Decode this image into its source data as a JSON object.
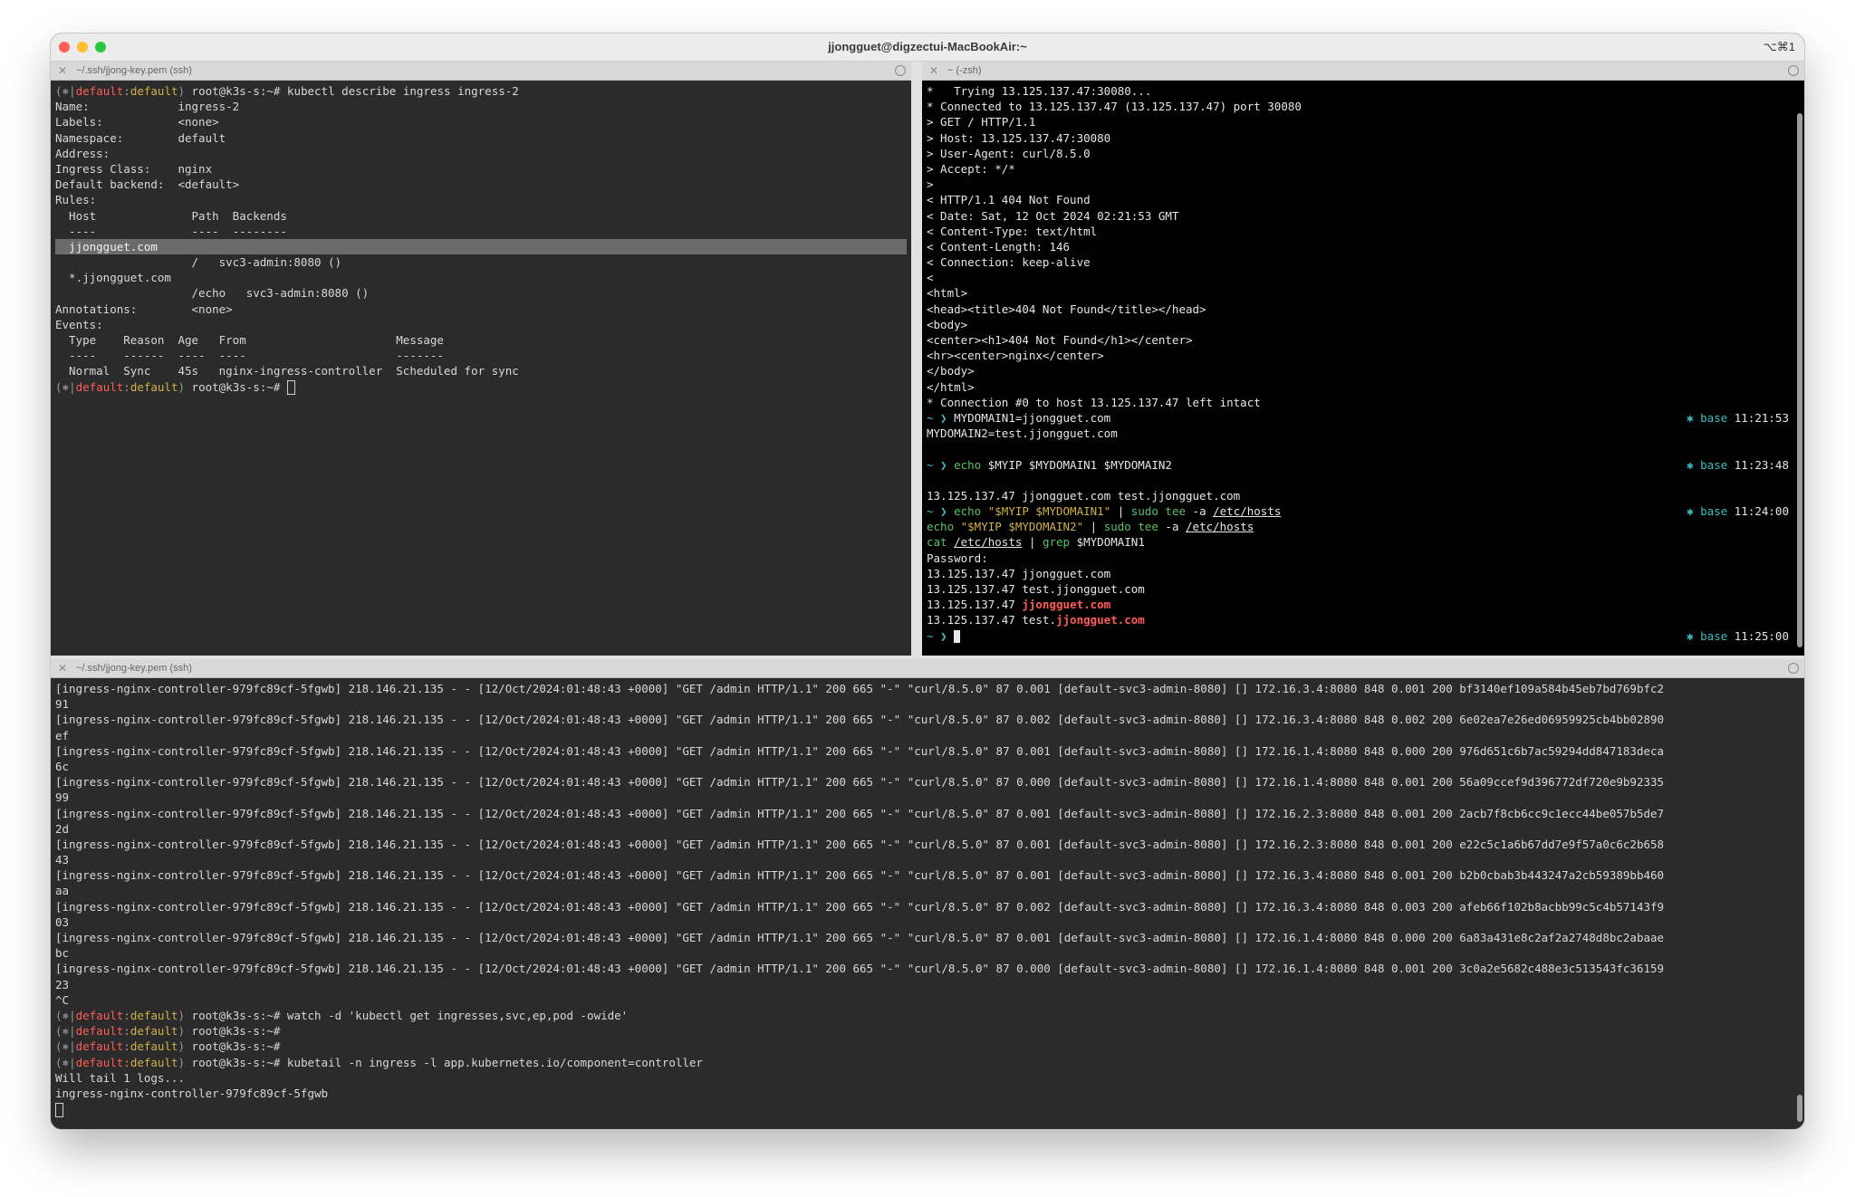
{
  "window": {
    "title": "jjongguet@digzectui-MacBookAir:~",
    "shortcut": "⌥⌘1"
  },
  "panes": {
    "left_top": {
      "tab_title": "~/.ssh/jjong-key.pem (ssh)",
      "lines": [
        "kubectl describe ingress ingress-2",
        "Name:             ingress-2",
        "Labels:           <none>",
        "Namespace:        default",
        "Address:",
        "Ingress Class:    nginx",
        "Default backend:  <default>",
        "Rules:",
        "  Host              Path  Backends",
        "  ----              ----  --------",
        "  jjongguet.com",
        "                    /   svc3-admin:8080 ()",
        "  *.jjongguet.com",
        "                    /echo   svc3-admin:8080 ()",
        "Annotations:        <none>",
        "Events:",
        "  Type    Reason  Age   From                      Message",
        "  ----    ------  ----  ----                      -------",
        "  Normal  Sync    45s   nginx-ingress-controller  Scheduled for sync"
      ]
    },
    "right_top": {
      "tab_title": "~ (-zsh)",
      "lines": [
        "*   Trying 13.125.137.47:30080...",
        "* Connected to 13.125.137.47 (13.125.137.47) port 30080",
        "> GET / HTTP/1.1",
        "> Host: 13.125.137.47:30080",
        "> User-Agent: curl/8.5.0",
        "> Accept: */*",
        ">",
        "< HTTP/1.1 404 Not Found",
        "< Date: Sat, 12 Oct 2024 02:21:53 GMT",
        "< Content-Type: text/html",
        "< Content-Length: 146",
        "< Connection: keep-alive",
        "<",
        "<html>",
        "<head><title>404 Not Found</title></head>",
        "<body>",
        "<center><h1>404 Not Found</h1></center>",
        "<hr><center>nginx</center>",
        "</body>",
        "</html>",
        "* Connection #0 to host 13.125.137.47 left intact"
      ],
      "cmd1": "MYDOMAIN1=jjongguet.com",
      "cmd1b": "MYDOMAIN2=test.jjongguet.com",
      "cmd2_echo": "echo",
      "cmd2_args": " $MYIP $MYDOMAIN1 $MYDOMAIN2",
      "cmd2_out": "13.125.137.47 jjongguet.com test.jjongguet.com",
      "cmd3_echo": "echo",
      "cmd3_str1": " \"$MYIP $MYDOMAIN1\"",
      "cmd3_pipe": " | ",
      "cmd3_sudo": "sudo",
      "cmd3_tee": " tee",
      "cmd3_flag": " -a ",
      "cmd3_file": "/etc/hosts",
      "cmd3b_str": " \"$MYIP $MYDOMAIN2\"",
      "cmd3c_cat": "cat",
      "cmd3c_sp": " ",
      "cmd3c_file": "/etc/hosts",
      "cmd3c_pipe": " | ",
      "cmd3c_grep": "grep",
      "cmd3c_arg": " $MYDOMAIN1",
      "password": "Password:",
      "out1": "13.125.137.47 jjongguet.com",
      "out2": "13.125.137.47 test.jjongguet.com",
      "out3_ip": "13.125.137.47 ",
      "out3_host": "jjongguet.com",
      "out4_ip": "13.125.137.47 test.",
      "out4_host": "jjongguet.com",
      "prompt_sym": "~ ❯",
      "status_env": "base",
      "status_marker": "✱",
      "times": [
        "11:21:53",
        "11:23:48",
        "11:24:00",
        "11:25:00"
      ]
    },
    "bottom": {
      "tab_title": "~/.ssh/jjong-key.pem (ssh)",
      "log_lines": [
        "[ingress-nginx-controller-979fc89cf-5fgwb] 218.146.21.135 - - [12/Oct/2024:01:48:43 +0000] \"GET /admin HTTP/1.1\" 200 665 \"-\" \"curl/8.5.0\" 87 0.001 [default-svc3-admin-8080] [] 172.16.3.4:8080 848 0.001 200 bf3140ef109a584b45eb7bd769bfc2",
        "91",
        "[ingress-nginx-controller-979fc89cf-5fgwb] 218.146.21.135 - - [12/Oct/2024:01:48:43 +0000] \"GET /admin HTTP/1.1\" 200 665 \"-\" \"curl/8.5.0\" 87 0.002 [default-svc3-admin-8080] [] 172.16.3.4:8080 848 0.002 200 6e02ea7e26ed06959925cb4bb02890",
        "ef",
        "[ingress-nginx-controller-979fc89cf-5fgwb] 218.146.21.135 - - [12/Oct/2024:01:48:43 +0000] \"GET /admin HTTP/1.1\" 200 665 \"-\" \"curl/8.5.0\" 87 0.001 [default-svc3-admin-8080] [] 172.16.1.4:8080 848 0.000 200 976d651c6b7ac59294dd847183deca",
        "6c",
        "[ingress-nginx-controller-979fc89cf-5fgwb] 218.146.21.135 - - [12/Oct/2024:01:48:43 +0000] \"GET /admin HTTP/1.1\" 200 665 \"-\" \"curl/8.5.0\" 87 0.000 [default-svc3-admin-8080] [] 172.16.1.4:8080 848 0.001 200 56a09ccef9d396772df720e9b92335",
        "99",
        "[ingress-nginx-controller-979fc89cf-5fgwb] 218.146.21.135 - - [12/Oct/2024:01:48:43 +0000] \"GET /admin HTTP/1.1\" 200 665 \"-\" \"curl/8.5.0\" 87 0.001 [default-svc3-admin-8080] [] 172.16.2.3:8080 848 0.001 200 2acb7f8cb6cc9c1ecc44be057b5de7",
        "2d",
        "[ingress-nginx-controller-979fc89cf-5fgwb] 218.146.21.135 - - [12/Oct/2024:01:48:43 +0000] \"GET /admin HTTP/1.1\" 200 665 \"-\" \"curl/8.5.0\" 87 0.001 [default-svc3-admin-8080] [] 172.16.2.3:8080 848 0.001 200 e22c5c1a6b67dd7e9f57a0c6c2b658",
        "43",
        "[ingress-nginx-controller-979fc89cf-5fgwb] 218.146.21.135 - - [12/Oct/2024:01:48:43 +0000] \"GET /admin HTTP/1.1\" 200 665 \"-\" \"curl/8.5.0\" 87 0.001 [default-svc3-admin-8080] [] 172.16.3.4:8080 848 0.001 200 b2b0cbab3b443247a2cb59389bb460",
        "aa",
        "[ingress-nginx-controller-979fc89cf-5fgwb] 218.146.21.135 - - [12/Oct/2024:01:48:43 +0000] \"GET /admin HTTP/1.1\" 200 665 \"-\" \"curl/8.5.0\" 87 0.002 [default-svc3-admin-8080] [] 172.16.3.4:8080 848 0.003 200 afeb66f102b8acbb99c5c4b57143f9",
        "03",
        "[ingress-nginx-controller-979fc89cf-5fgwb] 218.146.21.135 - - [12/Oct/2024:01:48:43 +0000] \"GET /admin HTTP/1.1\" 200 665 \"-\" \"curl/8.5.0\" 87 0.001 [default-svc3-admin-8080] [] 172.16.1.4:8080 848 0.000 200 6a83a431e8c2af2a2748d8bc2abaae",
        "bc",
        "[ingress-nginx-controller-979fc89cf-5fgwb] 218.146.21.135 - - [12/Oct/2024:01:48:43 +0000] \"GET /admin HTTP/1.1\" 200 665 \"-\" \"curl/8.5.0\" 87 0.000 [default-svc3-admin-8080] [] 172.16.1.4:8080 848 0.001 200 3c0a2e5682c488e3c513543fc36159",
        "23",
        "^C"
      ],
      "cmd_watch": "watch -d 'kubectl get ingresses,svc,ep,pod -owide'",
      "cmd_kubetail": "kubetail -n ingress -l app.kubernetes.io/component=controller",
      "out_tail1": "Will tail 1 logs...",
      "out_tail2": "ingress-nginx-controller-979fc89cf-5fgwb"
    }
  },
  "k8s_prompt": {
    "open": "(",
    "sym": "⎈",
    "bar": "|",
    "ctx": "default",
    "colon": ":",
    "ns": "default",
    "close": ")",
    "user": " root@k3s-s:~#"
  },
  "colors": {
    "terminal_bg_dark": "#2b2b2b",
    "terminal_bg_black": "#000000",
    "accent_red": "#ff5c57",
    "accent_cyan": "#3cbfbf",
    "accent_green": "#5ac16a"
  },
  "icons": {
    "close": "close-icon",
    "menu": "pane-menu-icon",
    "kube": "kubernetes-helm-icon"
  }
}
